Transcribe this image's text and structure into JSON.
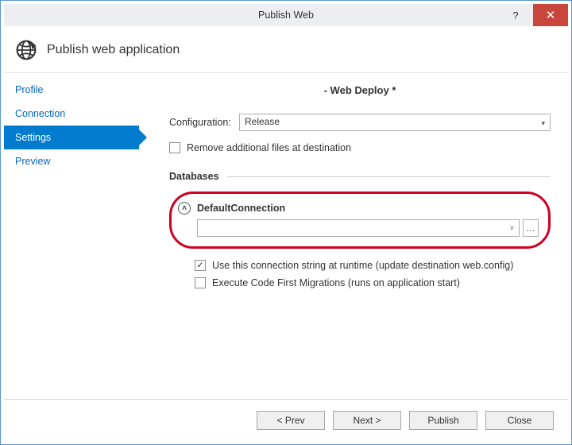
{
  "window": {
    "title": "Publish Web"
  },
  "header": {
    "text": "Publish web application"
  },
  "sidebar": {
    "items": [
      {
        "label": "Profile"
      },
      {
        "label": "Connection"
      },
      {
        "label": "Settings"
      },
      {
        "label": "Preview"
      }
    ],
    "active_index": 2
  },
  "main": {
    "deploy_title": "- Web Deploy *",
    "config_label": "Configuration:",
    "config_value": "Release",
    "remove_files_label": "Remove additional files at destination",
    "databases_head": "Databases",
    "connection_name": "DefaultConnection",
    "use_conn_label": "Use this connection string at runtime (update destination web.config)",
    "migrations_label": "Execute Code First Migrations (runs on application start)"
  },
  "footer": {
    "prev": "<  Prev",
    "next": "Next  >",
    "publish": "Publish",
    "close": "Close"
  }
}
